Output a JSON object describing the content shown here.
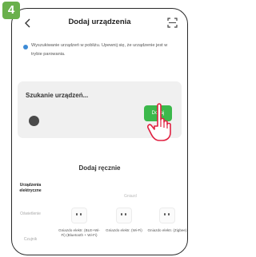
{
  "step": "4",
  "header": {
    "title": "Dodaj urządzenia",
    "back_icon": "back-chevron-icon",
    "scan_icon": "scan-frame-icon"
  },
  "notice": {
    "text": "Wyszukiwanie urządzeń w pobliżu. Upewnij się, że urządzenie jest w trybie parowania."
  },
  "search_card": {
    "title": "Szukanie urządzeń...",
    "add_button": "Dodaj"
  },
  "manual": {
    "title": "Dodaj ręcznie",
    "categories": [
      "Urządzenia elektryczne",
      "Oświetlenie",
      "Czujnik"
    ],
    "section_label": "Gniazd",
    "devices": [
      {
        "label": "Gniazdo elektr. (BLE+Wi-Fi) (Bluetooth + Wi-Fi)"
      },
      {
        "label": "Gniazdo elektr. (Wi-Fi)"
      },
      {
        "label": "Gniazdo elektr. (Zigbee)"
      }
    ]
  },
  "colors": {
    "accent": "#3cb84b",
    "badge": "#6ab04c"
  }
}
